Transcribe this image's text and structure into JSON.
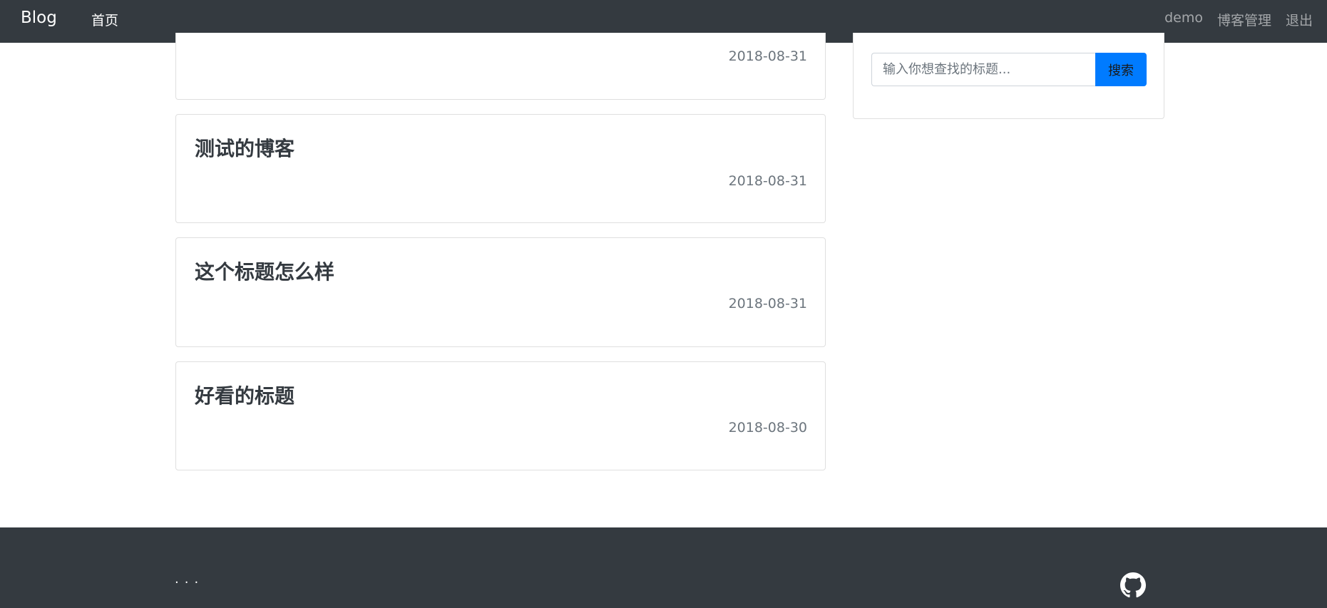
{
  "navbar": {
    "brand": "Blog",
    "home": "首页",
    "user": "demo",
    "manage": "博客管理",
    "logout": "退出"
  },
  "posts": [
    {
      "title": "",
      "date": "2018-08-31"
    },
    {
      "title": "测试的博客",
      "date": "2018-08-31"
    },
    {
      "title": "这个标题怎么样",
      "date": "2018-08-31"
    },
    {
      "title": "好看的标题",
      "date": "2018-08-30"
    }
  ],
  "search": {
    "placeholder": "输入你想查找的标题...",
    "value": "",
    "button": "搜索"
  },
  "footer": {
    "dots": "...",
    "icon": "github-icon"
  },
  "colors": {
    "navbar": "#343a40",
    "accent": "#007bff",
    "muted": "#6c757d"
  }
}
